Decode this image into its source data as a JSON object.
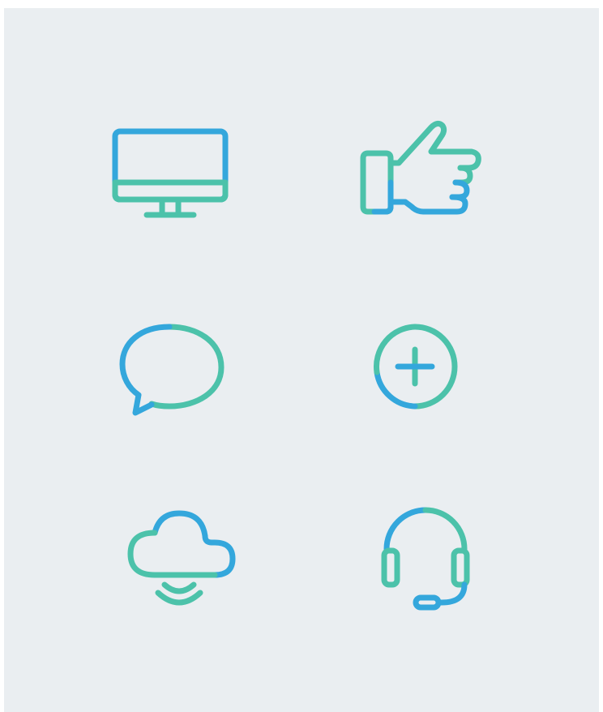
{
  "palette": {
    "blue": "#34a7dc",
    "teal": "#4cc2aa",
    "background": "#eaeef1"
  },
  "icons": [
    {
      "name": "monitor-icon"
    },
    {
      "name": "thumbs-up-icon"
    },
    {
      "name": "chat-bubble-icon"
    },
    {
      "name": "add-circle-icon"
    },
    {
      "name": "cloud-wireless-icon"
    },
    {
      "name": "headset-icon"
    }
  ]
}
